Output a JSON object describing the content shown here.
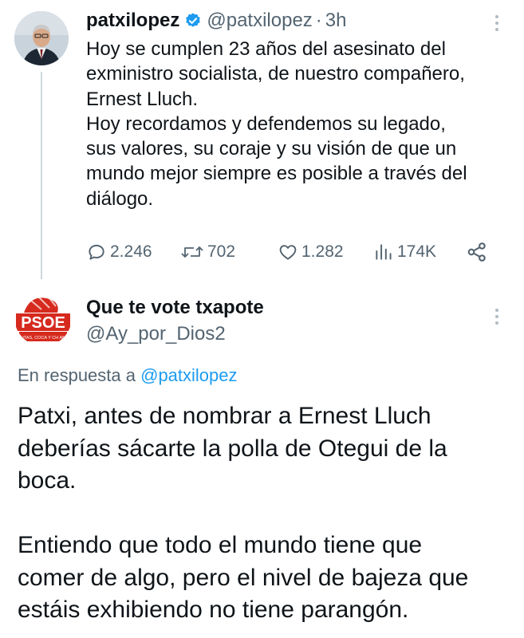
{
  "tweet": {
    "name": "patxilopez",
    "handle": "@patxilopez",
    "separator": "·",
    "time": "3h",
    "text": "Hoy se cumplen 23 años del asesinato del\nexministro socialista, de nuestro compañero,\nErnest Lluch.\nHoy recordamos y defendemos su legado,\nsus valores, su coraje y su visión de que un\nmundo mejor siempre es posible a través del\ndiálogo.",
    "replies": "2.246",
    "reposts": "702",
    "likes": "1.282",
    "views": "174K"
  },
  "reply": {
    "name": "Que te vote txapote",
    "handle": "@Ay_por_Dios2",
    "reply_prefix": "En respuesta a ",
    "reply_to": "@patxilopez",
    "avatar_text": "PSOE",
    "avatar_small_text": "PUTAS, COCA Y CH ANA",
    "text": "Patxi, antes de nombrar a Ernest Lluch\ndeberías sácarte la polla de Otegui de la\nboca.\n\nEntiendo que todo el mundo tiene que\ncomer de algo, pero el nivel de bajeza que\nestáis exhibiendo no tiene parangón."
  },
  "colors": {
    "verified": "#1d9bf0",
    "link": "#1d9bf0",
    "muted": "#536471",
    "psoe_red": "#d62a1e"
  },
  "icons": [
    "verified-badge-icon",
    "more-options-icon",
    "reply-icon",
    "repost-icon",
    "like-icon",
    "views-icon",
    "share-icon"
  ]
}
